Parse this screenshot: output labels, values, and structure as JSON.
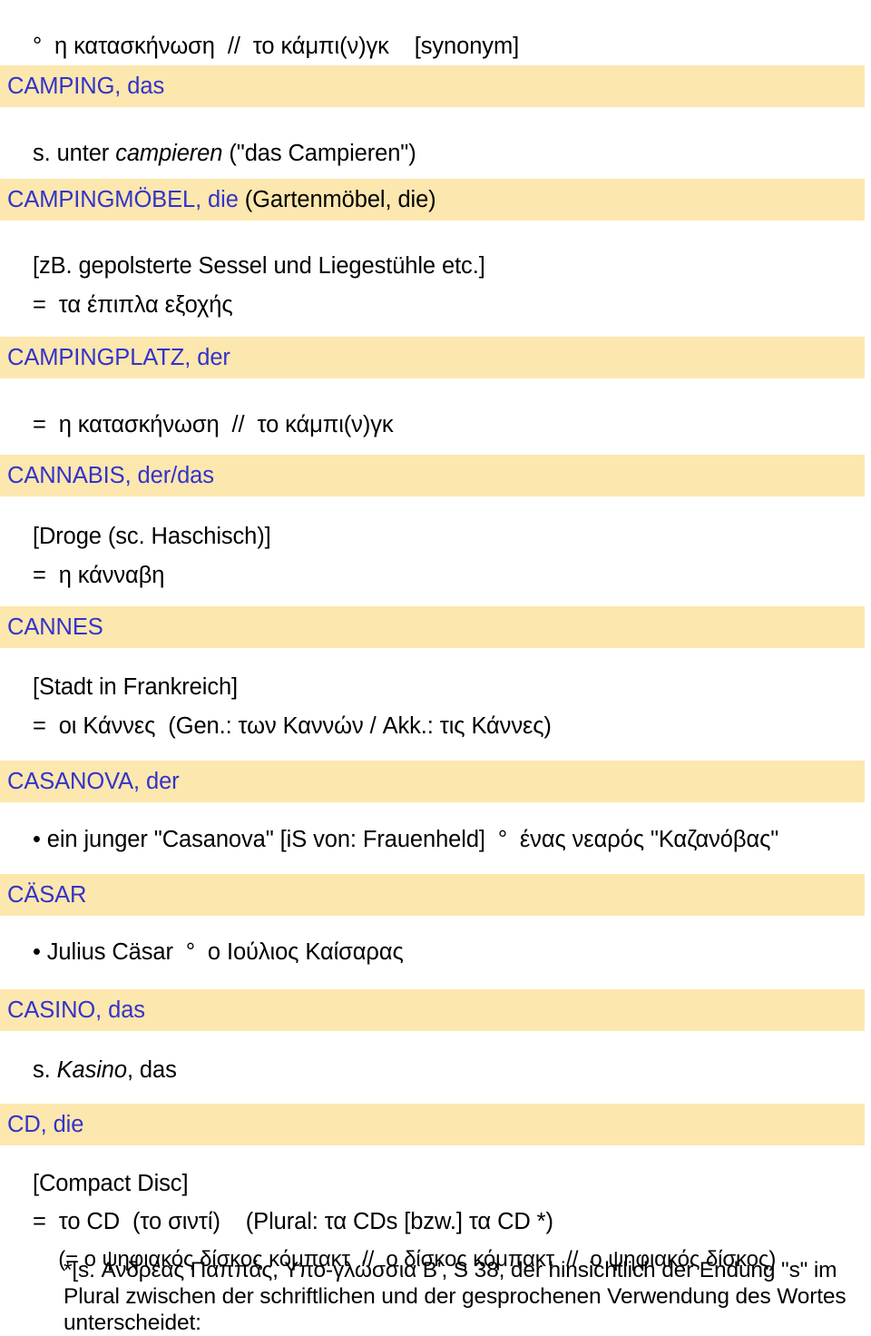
{
  "page": {
    "background_color": "#ffffff",
    "highlight_color": "#fce7ae",
    "headword_color": "#3333cc",
    "text_color": "#000000"
  },
  "top_line": "°  η κατασκήνωση  //  το κάμπι(ν)γκ    [synonym]",
  "entries": [
    {
      "id": "camping",
      "headword": "CAMPING, das",
      "gloss": "",
      "lines": [
        {
          "text": "s. unter ",
          "italic_part": "campieren",
          "tail": " (\"das Campieren\")",
          "indent": 0
        }
      ]
    },
    {
      "id": "campingmoebel",
      "headword": "CAMPINGMÖBEL, die",
      "gloss": " (Gartenmöbel, die)",
      "lines": [
        {
          "text": "[zB. gepolsterte Sessel und Liegestühle etc.]",
          "indent": 0
        },
        {
          "text": "=  τα έπιπλα εξοχής",
          "indent": 0
        }
      ]
    },
    {
      "id": "campingplatz",
      "headword": "CAMPINGPLATZ, der",
      "gloss": "",
      "lines": [
        {
          "text": "=  η κατασκήνωση  //  το κάμπι(ν)γκ",
          "indent": 0
        }
      ]
    },
    {
      "id": "cannabis",
      "headword": "CANNABIS, der/das",
      "gloss": "",
      "lines": [
        {
          "text": "[Droge (sc. Haschisch)]",
          "indent": 0
        },
        {
          "text": "=  η κάνναβη",
          "indent": 0
        }
      ]
    },
    {
      "id": "cannes",
      "headword": "CANNES",
      "gloss": "",
      "lines": [
        {
          "text": "[Stadt in Frankreich]",
          "indent": 0
        },
        {
          "text": "=  οι Κάννες  (Gen.: των Καννών / Akk.: τις Κάννες)",
          "indent": 0
        }
      ]
    },
    {
      "id": "casanova",
      "headword": "CASANOVA, der",
      "gloss": "",
      "lines": [
        {
          "text": "• ein junger \"Casanova\" [iS von: Frauenheld]  °  ένας νεαρός \"Καζανόβας\"",
          "indent": 0
        }
      ]
    },
    {
      "id": "caesar",
      "headword": "CÄSAR",
      "gloss": "",
      "lines": [
        {
          "text": "• Julius Cäsar  °  ο Ιούλιος Καίσαρας",
          "indent": 0
        }
      ]
    },
    {
      "id": "casino",
      "headword": "CASINO, das",
      "gloss": "",
      "lines": [
        {
          "text": "s. ",
          "italic_part": "Kasino",
          "tail": ", das",
          "indent": 0
        }
      ]
    },
    {
      "id": "cd",
      "headword": "CD, die",
      "gloss": "",
      "lines": [
        {
          "text": "[Compact Disc]",
          "indent": 0
        },
        {
          "text": "=  το CD  (το σιντί)    (Plural: τα CDs [bzw.] τα CD *)",
          "indent": 0
        },
        {
          "text": "(= ο ψηφιακός δίσκος κόμπακτ  //  ο δίσκος κόμπακτ  //  ο ψηφιακός δίσκος)",
          "indent": 1
        }
      ],
      "footnote": "*[s. Ανδρέας Παππάς, Υπο-γλώσσια Β', S 38, der hinsichtlich der Endung \"s\" im Plural zwischen der schriftlichen und der gesprochenen Verwendung des Wortes unterscheidet:"
    }
  ]
}
